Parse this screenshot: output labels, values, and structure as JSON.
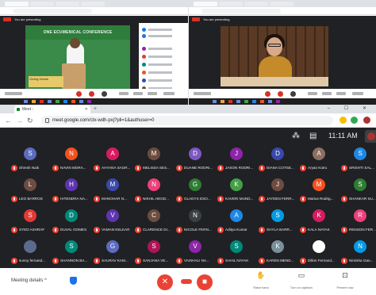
{
  "top_left": {
    "header": "You are presenting",
    "slide_banner": "ONE ECUMENICAL CONFERENCE",
    "slide_sub": "Giving Hands"
  },
  "top_right": {
    "header": "You are presenting"
  },
  "browser": {
    "tab_title": "Meet - ",
    "url": "meet.google.com/ctx-wdh-pxj?pli=1&authuser=0",
    "win_controls": "– ☐ ✕"
  },
  "meet": {
    "time": "11:11 AM",
    "meeting_details_label": "Meeting details",
    "chevron": "^",
    "right_buttons": [
      {
        "label": "Raise hand",
        "icon": "✋"
      },
      {
        "label": "Turn on captions",
        "icon": "▭"
      },
      {
        "label": "Present now",
        "icon": "⊡"
      }
    ],
    "participants": [
      {
        "name": "Shresh Naik",
        "initial": "S",
        "color": "#5c6bc0"
      },
      {
        "name": "NAVIN MORA...",
        "initial": "N",
        "color": "#f4511e"
      },
      {
        "name": "AHYANA SAGR...",
        "initial": "A",
        "color": "#d81b60"
      },
      {
        "name": "MELISSA SES...",
        "initial": "M",
        "color": "#6d4c41"
      },
      {
        "name": "DUANE RODRI...",
        "initial": "D",
        "color": "#7e57c2"
      },
      {
        "name": "JASON RODRI...",
        "initial": "J",
        "color": "#8e24aa"
      },
      {
        "name": "DIANA COTSE...",
        "initial": "D",
        "color": "#3949ab"
      },
      {
        "name": "Aryan Kotru",
        "initial": "A",
        "color": "#8d6e63"
      },
      {
        "name": "SRISHTI SAL...",
        "initial": "S",
        "color": "#1e88e5"
      },
      {
        "name": "LEO BARROS",
        "initial": "L",
        "color": "#6d4c41"
      },
      {
        "name": "HITENDRA NA...",
        "initial": "H",
        "color": "#5e35b1"
      },
      {
        "name": "MANOHAR N...",
        "initial": "M",
        "color": "#3949ab"
      },
      {
        "name": "NIKHIL HEGD...",
        "initial": "N",
        "color": "#ec407a"
      },
      {
        "name": "GLADYS DSO...",
        "initial": "G",
        "color": "#2e7d32"
      },
      {
        "name": "KAVERI MUND...",
        "initial": "K",
        "color": "#43a047"
      },
      {
        "name": "JAYDEN FERR...",
        "initial": "J",
        "color": "#6d4c41"
      },
      {
        "name": "Marius Rodrig...",
        "initial": "M",
        "color": "#f4511e"
      },
      {
        "name": "SHANKAR SU...",
        "initial": "S",
        "color": "#2e7d32"
      },
      {
        "name": "SYED ASHRAF",
        "initial": "S",
        "color": "#e53935"
      },
      {
        "name": "DUVAL GOMES",
        "initial": "D",
        "color": "#00897b"
      },
      {
        "name": "VAMAN KELKAR",
        "initial": "V",
        "color": "#5e35b1"
      },
      {
        "name": "CLARENCE DI...",
        "initial": "C",
        "color": "#6d4c41"
      },
      {
        "name": "NICOLE FERN...",
        "initial": "N",
        "color": "#3c4043"
      },
      {
        "name": "Aditya Kumar",
        "initial": "A",
        "color": "#1e88e5"
      },
      {
        "name": "SHYLA BARR...",
        "initial": "S",
        "color": "#039be5"
      },
      {
        "name": "KALA NAYAK",
        "initial": "K",
        "color": "#d81b60"
      },
      {
        "name": "RENSON FER...",
        "initial": "R",
        "color": "#ec407a"
      },
      {
        "name": "sunny fernand...",
        "initial": "",
        "color": "#5a6b8c"
      },
      {
        "name": "SHANNON BA...",
        "initial": "S",
        "color": "#00897b"
      },
      {
        "name": "SAURAV KAM...",
        "initial": "G",
        "color": "#5c6bc0"
      },
      {
        "name": "SANJANA VE...",
        "initial": "S",
        "color": "#ad1457"
      },
      {
        "name": "VAISHALI NA...",
        "initial": "V",
        "color": "#8e24aa"
      },
      {
        "name": "SAHIL NAYAK",
        "initial": "S",
        "color": "#00897b"
      },
      {
        "name": "KAREN MEND...",
        "initial": "K",
        "color": "#78909c"
      },
      {
        "name": "Dillon Fernand...",
        "initial": "",
        "color": "#ffffff"
      },
      {
        "name": "Nimisha Gao...",
        "initial": "N",
        "color": "#039be5"
      }
    ]
  }
}
